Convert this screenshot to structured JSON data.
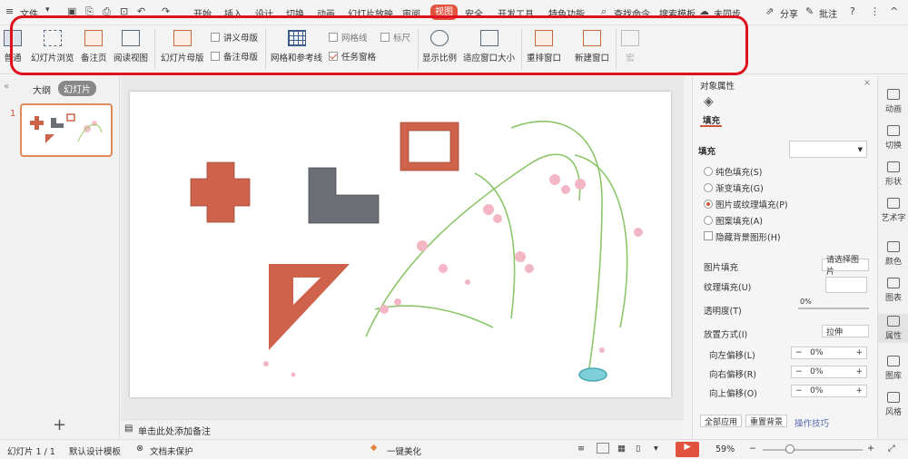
{
  "menubar": {
    "file_label": "文件",
    "tabs": [
      "开始",
      "插入",
      "设计",
      "切换",
      "动画",
      "幻灯片放映",
      "审阅",
      "视图",
      "安全",
      "开发工具",
      "特色功能"
    ],
    "search_label": "查找命令、搜索模板",
    "sync_label": "未同步",
    "share_label": "分享",
    "comment_label": "批注"
  },
  "ribbon": {
    "normal_label": "普通",
    "sorter_label": "幻灯片浏览",
    "notes_page_label": "备注页",
    "reading_label": "阅读视图",
    "slide_master_label": "幻灯片母版",
    "handout_master_label": "讲义母版",
    "notes_master_label": "备注母版",
    "grid_guides_label": "网格和参考线",
    "gridlines_label": "网格线",
    "ruler_label": "标尺",
    "task_pane_label": "任务窗格",
    "zoom_label": "显示比例",
    "fit_label": "适应窗口大小",
    "arrange_label": "重排窗口",
    "new_window_label": "新建窗口",
    "macro_label": "宏"
  },
  "leftpanel": {
    "outline_label": "大纲",
    "slides_label": "幻灯片",
    "slide_number": "1",
    "add_symbol": "+"
  },
  "notes": {
    "placeholder": "单击此处添加备注"
  },
  "props": {
    "title": "对象属性",
    "fill_tab": "填充",
    "fill_section": "填充",
    "options": [
      "纯色填充(S)",
      "渐变填充(G)",
      "图片或纹理填充(P)",
      "图案填充(A)"
    ],
    "hide_bg": "隐藏背景图形(H)",
    "picture_fill_label": "图片填充",
    "picture_fill_value": "请选择图片",
    "texture_fill_label": "纹理填充(U)",
    "transparency_label": "透明度(T)",
    "transparency_value": "0%",
    "placement_label": "放置方式(I)",
    "placement_value": "拉伸",
    "offset_left_label": "向左偏移(L)",
    "offset_left_value": "0%",
    "offset_right_label": "向右偏移(R)",
    "offset_right_value": "0%",
    "offset_top_label": "向上偏移(O)",
    "offset_top_value": "0%",
    "apply_all": "全部应用",
    "reset_bg": "重置背景",
    "tips": "操作技巧"
  },
  "rightbar": [
    "动画",
    "切换",
    "形状",
    "艺术字",
    "颜色",
    "图表",
    "属性",
    "图库",
    "风格"
  ],
  "status": {
    "slide_info": "幻灯片 1 / 1",
    "template": "默认设计模板",
    "protection": "文档未保护",
    "beautify": "一键美化",
    "zoom": "59%"
  },
  "colors": {
    "accent": "#e2533f",
    "shape": "#cf624a",
    "gray_shape": "#6b6e74",
    "highlight": "#e0111e"
  }
}
